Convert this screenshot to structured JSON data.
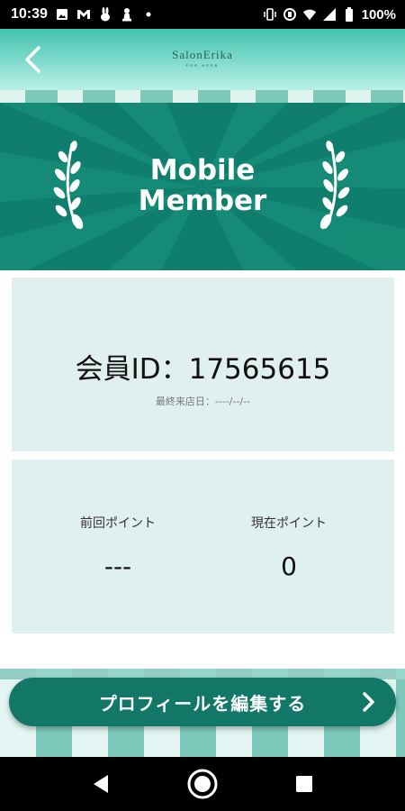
{
  "status_bar": {
    "time": "10:39",
    "left_icons": [
      "image-icon",
      "gmail-icon",
      "rabbit-icon",
      "chess-pawn-icon",
      "dot-icon"
    ],
    "right_icons": [
      "vibrate-icon",
      "data-saver-icon",
      "wifi-icon",
      "signal-icon",
      "battery-icon"
    ],
    "battery": "100%"
  },
  "header": {
    "back_icon": "chevron-left-icon",
    "brand_name": "SalonErika",
    "brand_sub": "FOR HERB"
  },
  "banner": {
    "title_line1": "Mobile",
    "title_line2": "Member",
    "icon": "laurel-icon"
  },
  "member_card": {
    "member_id": "会員ID：17565615",
    "last_visit": "最終来店日：----/--/--"
  },
  "points": {
    "previous_label": "前回ポイント",
    "previous_value": "---",
    "current_label": "現在ポイント",
    "current_value": "0"
  },
  "edit_button": {
    "label": "プロフィールを編集する",
    "icon": "chevron-right-icon"
  },
  "nav_bar": {
    "icons": [
      "nav-back-icon",
      "nav-home-icon",
      "nav-recents-icon"
    ]
  },
  "colors": {
    "banner": "#0f7e6c",
    "card": "#dff0ee",
    "button": "#127766",
    "header_top": "#41c3ae"
  }
}
